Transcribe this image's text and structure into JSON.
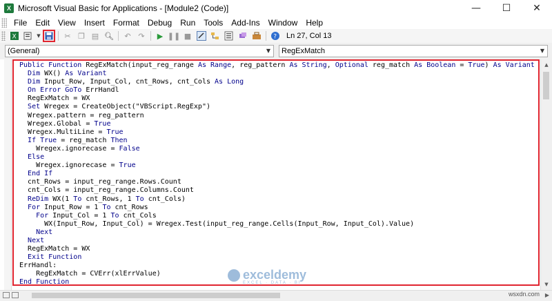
{
  "window": {
    "title": "Microsoft Visual Basic for Applications - [Module2 (Code)]",
    "controls": [
      "—",
      "☐",
      "✕"
    ]
  },
  "menu": {
    "items": [
      "File",
      "Edit",
      "View",
      "Insert",
      "Format",
      "Debug",
      "Run",
      "Tools",
      "Add-Ins",
      "Window",
      "Help"
    ]
  },
  "toolbar": {
    "status": "Ln 27, Col 13",
    "icons": [
      "excel-icon",
      "insert-module-icon",
      "save-icon",
      "cut-icon",
      "copy-icon",
      "paste-icon",
      "find-icon",
      "undo-icon",
      "redo-icon",
      "run-icon",
      "break-icon",
      "reset-icon",
      "design-mode-icon",
      "project-explorer-icon",
      "properties-icon",
      "object-browser-icon",
      "toolbox-icon",
      "help-icon"
    ]
  },
  "combos": {
    "object": "(General)",
    "procedure": "RegExMatch"
  },
  "code": {
    "lines": [
      "Public Function RegExMatch(input_reg_range As Range, reg_pattern As String, Optional reg_match As Boolean = True) As Variant",
      "  Dim WX() As Variant",
      "  Dim Input_Row, Input_Col, cnt_Rows, cnt_Cols As Long",
      "  On Error GoTo ErrHandl",
      "  RegExMatch = WX",
      "  Set Wregex = CreateObject(\"VBScript.RegExp\")",
      "  Wregex.pattern = reg_pattern",
      "  Wregex.Global = True",
      "  Wregex.MultiLine = True",
      "  If True = reg_match Then",
      "    Wregex.ignorecase = False",
      "  Else",
      "    Wregex.ignorecase = True",
      "  End If",
      "  cnt_Rows = input_reg_range.Rows.Count",
      "  cnt_Cols = input_reg_range.Columns.Count",
      "  ReDim WX(1 To cnt_Rows, 1 To cnt_Cols)",
      "  For Input_Row = 1 To cnt_Rows",
      "    For Input_Col = 1 To cnt_Cols",
      "      WX(Input_Row, Input_Col) = Wregex.Test(input_reg_range.Cells(Input_Row, Input_Col).Value)",
      "    Next",
      "  Next",
      "  RegExMatch = WX",
      "  Exit Function",
      "ErrHandl:",
      "    RegExMatch = CVErr(xlErrValue)",
      "End Function"
    ],
    "keywords": [
      "Public",
      "Function",
      "As",
      "Range",
      "String",
      "Optional",
      "Boolean",
      "True",
      "False",
      "Variant",
      "Dim",
      "Long",
      "On",
      "Error",
      "GoTo",
      "Set",
      "If",
      "Then",
      "Else",
      "End",
      "ReDim",
      "To",
      "For",
      "Next",
      "Exit"
    ]
  },
  "watermark": {
    "name": "exceldemy",
    "tagline": "EXCEL · DATA · BI"
  },
  "credit": "wsxdn.com",
  "colors": {
    "keyword": "#00008b",
    "highlight_border": "#e0242f"
  }
}
